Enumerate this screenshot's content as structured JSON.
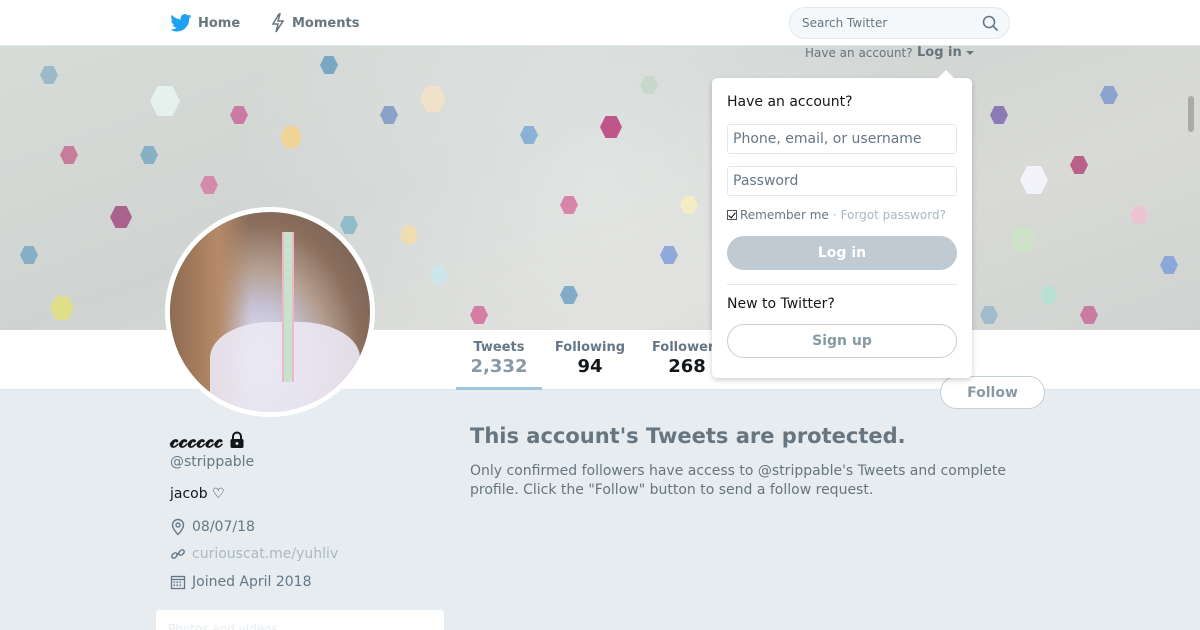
{
  "nav": {
    "home_label": "Home",
    "moments_label": "Moments",
    "search_placeholder": "Search Twitter",
    "brand_color": "#1da1f2"
  },
  "header": {
    "have_account_text": "Have an account?",
    "login_toggle_label": "Log in"
  },
  "profile": {
    "display_name": "𝓬𝓬𝓬𝓬𝓬𝓬",
    "screen_name": "@strippable",
    "bio": "jacob ♡",
    "location": "08/07/18",
    "url": "curiouscat.me/yuhliv",
    "joined": "Joined April 2018",
    "follow_button": "Follow",
    "photos_card_text": "Photos and videos"
  },
  "stats": [
    {
      "label": "Tweets",
      "value": "2,332"
    },
    {
      "label": "Following",
      "value": "94"
    },
    {
      "label": "Followers",
      "value": "268"
    }
  ],
  "protected": {
    "title": "This account's Tweets are protected.",
    "text": "Only confirmed followers have access to @strippable's Tweets and complete profile. Click the \"Follow\" button to send a follow request."
  },
  "login_dropdown": {
    "heading": "Have an account?",
    "username_placeholder": "Phone, email, or username",
    "password_placeholder": "Password",
    "remember_label": "Remember me",
    "separator": "·",
    "forgot_label": "Forgot password?",
    "login_button": "Log in",
    "new_heading": "New to Twitter?",
    "signup_button": "Sign up"
  },
  "icons": {
    "logo": "twitter-bird-icon",
    "moments": "lightning-icon",
    "search": "search-icon",
    "lock": "lock-icon",
    "location": "location-pin-icon",
    "link": "link-icon",
    "calendar": "calendar-icon"
  }
}
